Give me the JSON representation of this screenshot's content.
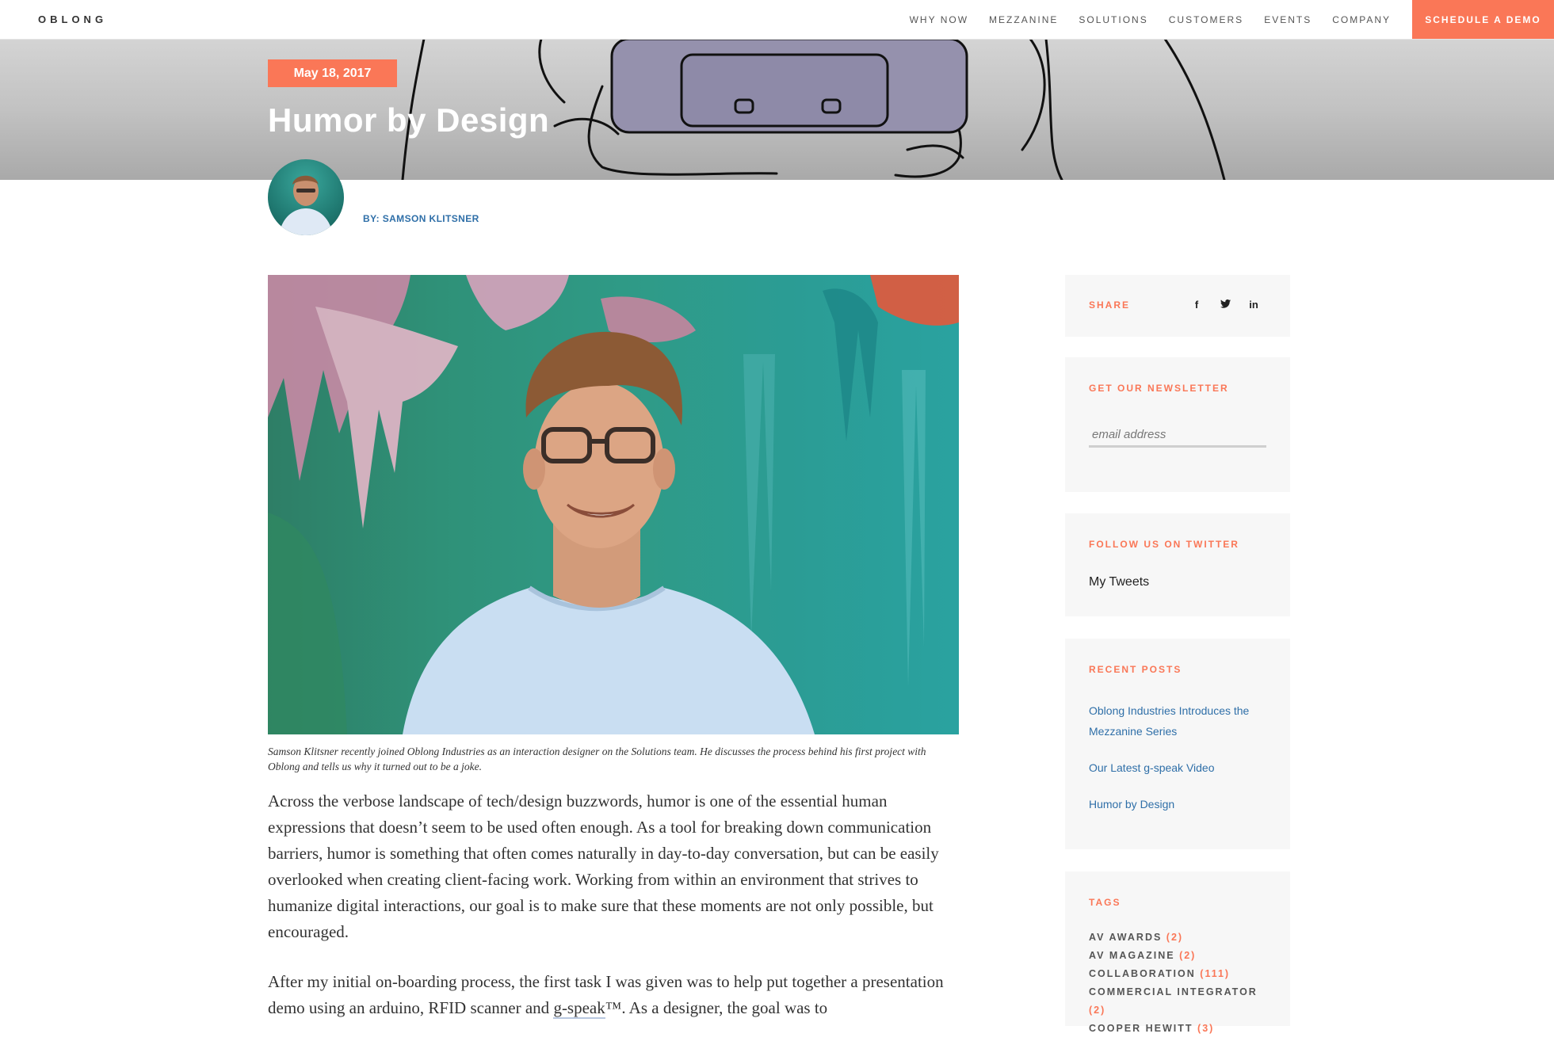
{
  "nav": {
    "logo": "OBLONG",
    "links": [
      "WHY NOW",
      "MEZZANINE",
      "SOLUTIONS",
      "CUSTOMERS",
      "EVENTS",
      "COMPANY"
    ],
    "cta": "SCHEDULE A DEMO"
  },
  "post": {
    "date": "May 18, 2017",
    "title": "Humor by Design",
    "author": "BY: SAMSON KLITSNER",
    "caption": "Samson Klitsner recently joined Oblong Industries as an interaction designer on the Solutions team. He discusses the process behind his first project with Oblong and tells us why it turned out to be a joke.",
    "paragraph1": "Across the verbose landscape of tech/design buzzwords, humor is one of the essential human expressions that doesn’t seem to be used often enough. As a tool for breaking down communication barriers, humor is something that often comes naturally in day-to-day conversation, but can be easily overlooked when creating client-facing work. Working from within an environment that strives to humanize digital interactions, our goal is to make sure that these moments are not only possible, but encouraged.",
    "paragraph2_a": "After my initial on-boarding process, the first task I was given was to help put together a presentation demo using an arduino, RFID scanner and ",
    "paragraph2_link": "g-speak",
    "paragraph2_b": "™. As a designer, the goal was to"
  },
  "sidebar": {
    "share": {
      "title": "SHARE",
      "icons": [
        {
          "name": "facebook-icon",
          "glyph": "f"
        },
        {
          "name": "twitter-icon",
          "glyph": "🐦"
        },
        {
          "name": "linkedin-icon",
          "glyph": "in"
        }
      ]
    },
    "newsletter": {
      "title": "GET OUR NEWSLETTER",
      "placeholder": "email address"
    },
    "twitter": {
      "title": "FOLLOW US ON TWITTER",
      "link": "My Tweets"
    },
    "recent": {
      "title": "RECENT POSTS",
      "items": [
        "Oblong Industries Introduces the Mezzanine Series",
        "Our Latest g-speak Video",
        "Humor by Design"
      ]
    },
    "tags": {
      "title": "TAGS",
      "items": [
        {
          "label": "AV AWARDS",
          "count": "(2)"
        },
        {
          "label": "AV MAGAZINE",
          "count": "(2)"
        },
        {
          "label": "COLLABORATION",
          "count": "(111)"
        },
        {
          "label": "COMMERCIAL INTEGRATOR",
          "count": "(2)"
        },
        {
          "label": "COOPER HEWITT",
          "count": "(3)"
        }
      ]
    }
  },
  "colors": {
    "accent": "#fa7757",
    "link": "#2f6fa8",
    "widget_bg": "#f7f7f7"
  }
}
